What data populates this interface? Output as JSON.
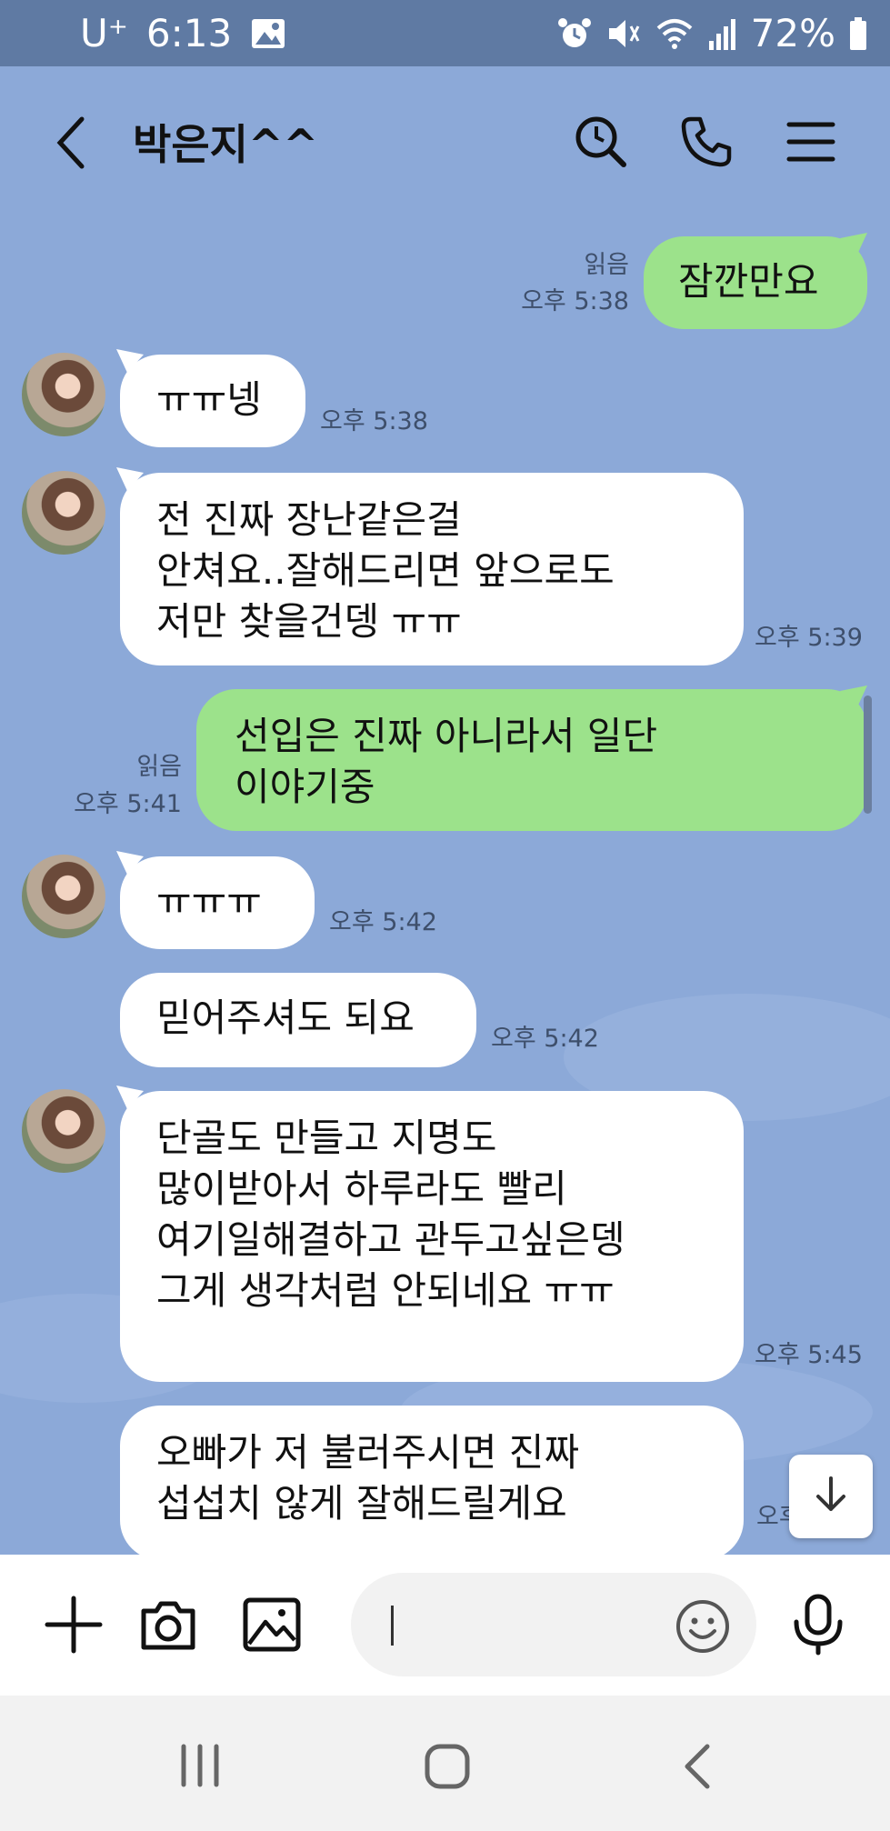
{
  "status_bar": {
    "carrier": "U⁺",
    "time": "6:13",
    "battery": "72%"
  },
  "header": {
    "title": "박은지^^"
  },
  "messages": [
    {
      "direction": "out",
      "text": "잠깐만요",
      "read": "읽음",
      "time": "오후 5:38"
    },
    {
      "direction": "in",
      "text": "ㅠㅠ넹",
      "time": "오후 5:38"
    },
    {
      "direction": "in",
      "text": "전 진짜 장난같은걸\n안쳐요..잘해드리면 앞으로도\n저만 찾을건뎅 ㅠㅠ",
      "time": "오후 5:39"
    },
    {
      "direction": "out",
      "text": "선입은 진짜 아니라서 일단\n이야기중",
      "read": "읽음",
      "time": "오후 5:41"
    },
    {
      "direction": "in",
      "text": "ㅠㅠㅠ",
      "time": "오후 5:42"
    },
    {
      "direction": "in",
      "text": "믿어주셔도 되요",
      "time": "오후 5:42"
    },
    {
      "direction": "in",
      "text": "단골도 만들고 지명도\n많이받아서 하루라도 빨리\n여기일해결하고 관두고싶은뎅\n그게 생각처럼 안되네요 ㅠㅠ",
      "time": "오후 5:45"
    },
    {
      "direction": "in",
      "text": "오빠가 저 불러주시면 진짜\n섭섭치 않게 잘해드릴게요",
      "time": "오후"
    }
  ],
  "icons": {
    "back": "back-arrow-icon",
    "search": "search-icon",
    "call": "phone-icon",
    "menu": "menu-icon",
    "scroll_down": "arrow-down-icon",
    "add": "plus-icon",
    "camera": "camera-icon",
    "gallery": "image-icon",
    "emoji": "emoji-icon",
    "mic": "microphone-icon"
  },
  "colors": {
    "chat_background": "#8ca9d8",
    "incoming_bubble": "#ffffff",
    "outgoing_bubble": "#9ce28b",
    "status_bar": "#5f7aa3"
  }
}
